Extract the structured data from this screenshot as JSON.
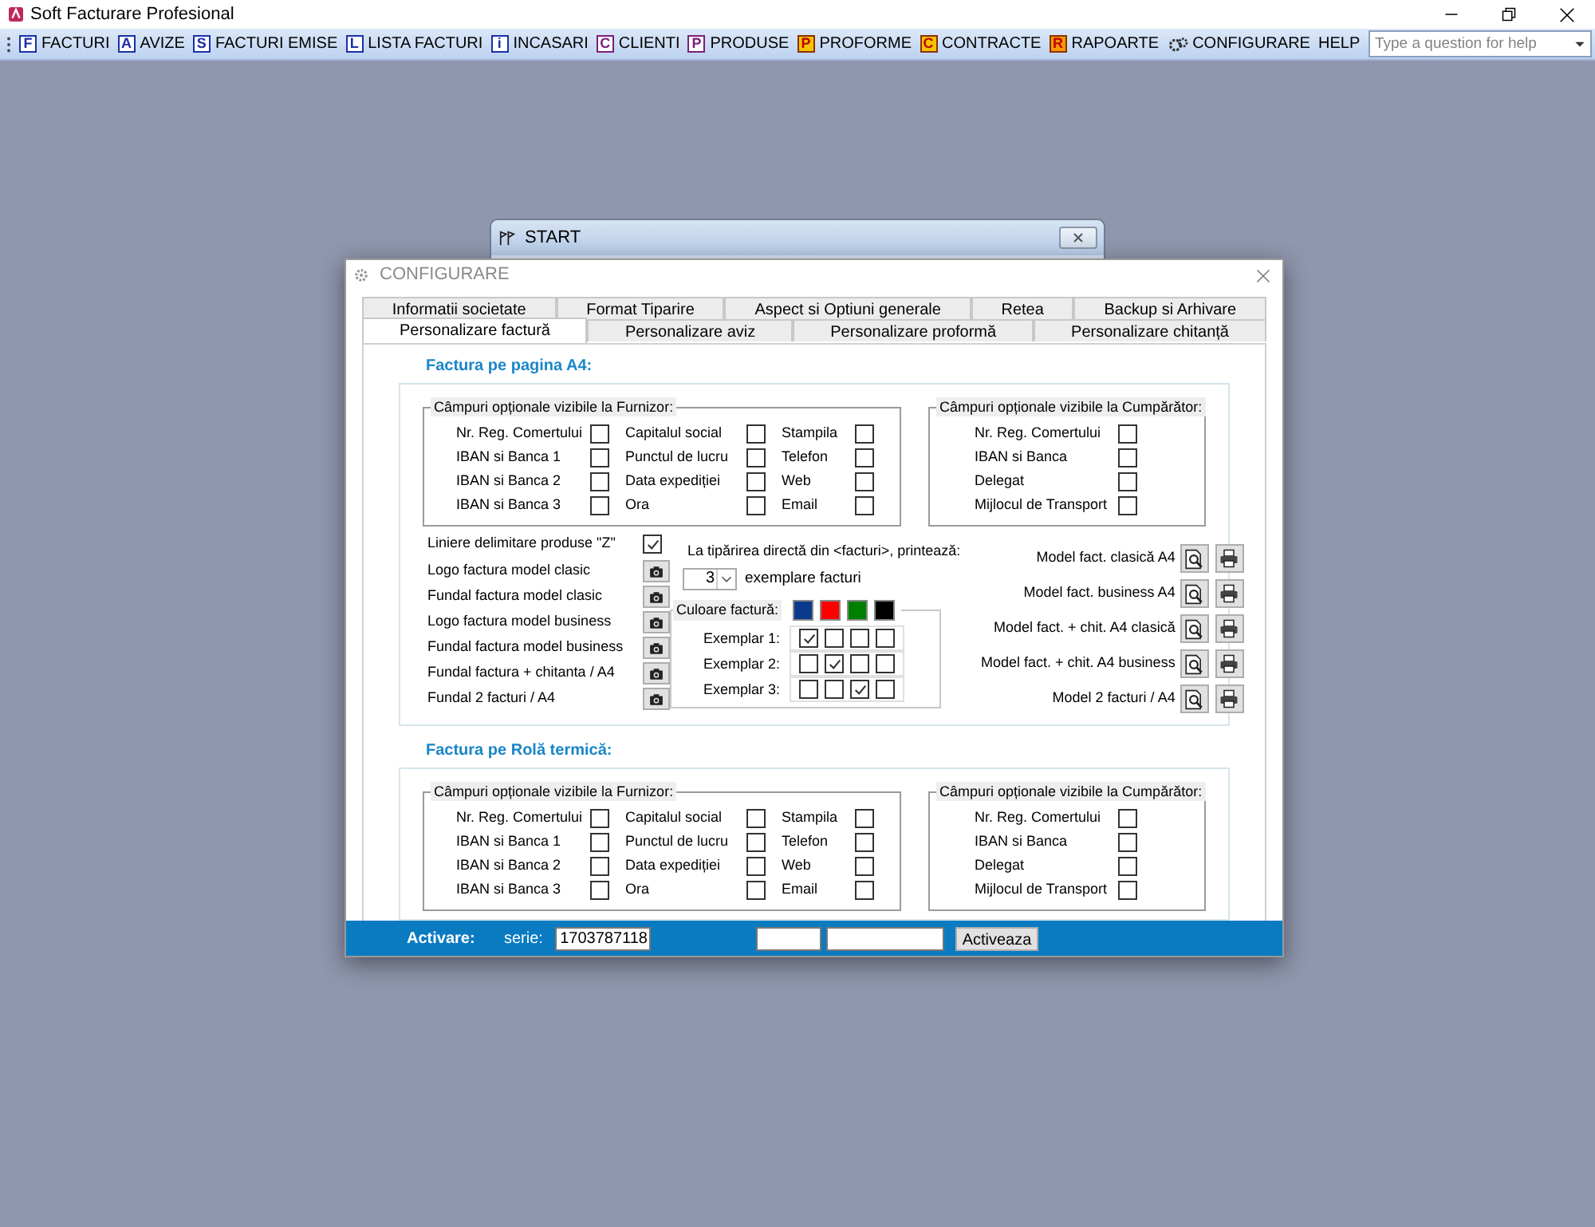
{
  "app_title": "Soft Facturare Profesional",
  "menu": [
    {
      "label": "FACTURI",
      "kind": "outline",
      "icon": "F",
      "color": "#1a2fa8"
    },
    {
      "label": "AVIZE",
      "kind": "outline",
      "icon": "A",
      "color": "#1a2fa8"
    },
    {
      "label": "FACTURI EMISE",
      "kind": "outline",
      "icon": "S",
      "color": "#1a2fa8"
    },
    {
      "label": "LISTA FACTURI",
      "kind": "outline",
      "icon": "L",
      "color": "#1a2fa8"
    },
    {
      "label": "INCASARI",
      "kind": "outline",
      "icon": "i",
      "color": "#1a2fa8"
    },
    {
      "label": "CLIENTI",
      "kind": "outline",
      "icon": "C",
      "color": "#7a1f7a"
    },
    {
      "label": "PRODUSE",
      "kind": "outline",
      "icon": "P",
      "color": "#7a1f7a"
    },
    {
      "label": "PROFORME",
      "kind": "filled",
      "icon": "P",
      "color": "#f5c400"
    },
    {
      "label": "CONTRACTE",
      "kind": "filled",
      "icon": "C",
      "color": "#f5c400"
    },
    {
      "label": "RAPOARTE",
      "kind": "filled",
      "icon": "R",
      "color": "#f59a00"
    },
    {
      "label": "CONFIGURARE",
      "kind": "gear"
    },
    {
      "label": "HELP",
      "kind": "none"
    }
  ],
  "help_search": {
    "placeholder": "Type a question for help"
  },
  "start_window": {
    "title": "START"
  },
  "dialog": {
    "title": "CONFIGURARE",
    "tab_rows": [
      [
        {
          "label": "Informatii societate",
          "selected": false
        },
        {
          "label": "Format Tiparire",
          "selected": false
        },
        {
          "label": "Aspect si Optiuni generale",
          "selected": false
        },
        {
          "label": "Retea",
          "selected": false
        },
        {
          "label": "Backup si Arhivare",
          "selected": false
        }
      ],
      [
        {
          "label": "Personalizare factură",
          "selected": true
        },
        {
          "label": "Personalizare aviz",
          "selected": false
        },
        {
          "label": "Personalizare proformă",
          "selected": false
        },
        {
          "label": "Personalizare chitanță",
          "selected": false
        }
      ]
    ],
    "a4": {
      "title": "Factura pe pagina A4:",
      "furnizor": {
        "legend": "Câmpuri opționale vizibile la Furnizor:",
        "columns": [
          [
            {
              "label": "Nr. Reg. Comertului",
              "checked": false
            },
            {
              "label": "IBAN si Banca 1",
              "checked": false
            },
            {
              "label": "IBAN si Banca 2",
              "checked": false
            },
            {
              "label": "IBAN si Banca 3",
              "checked": false
            }
          ],
          [
            {
              "label": "Capitalul social",
              "checked": false
            },
            {
              "label": "Punctul de lucru",
              "checked": false
            },
            {
              "label": "Data expediției",
              "checked": false
            },
            {
              "label": "Ora",
              "checked": false
            }
          ],
          [
            {
              "label": "Stampila",
              "checked": false
            },
            {
              "label": "Telefon",
              "checked": false
            },
            {
              "label": "Web",
              "checked": false
            },
            {
              "label": "Email",
              "checked": false
            }
          ]
        ]
      },
      "cumparator": {
        "legend": "Câmpuri opționale vizibile la Cumpărător:",
        "columns": [
          [
            {
              "label": "Nr. Reg. Comertului",
              "checked": false
            },
            {
              "label": "IBAN si Banca",
              "checked": false
            },
            {
              "label": "Delegat",
              "checked": false
            },
            {
              "label": "Mijlocul de Transport",
              "checked": false
            }
          ]
        ]
      },
      "lines": {
        "label": "Liniere delimitare produse \"Z\"",
        "checked": true
      },
      "images": [
        "Logo factura model clasic",
        "Fundal factura model clasic",
        "Logo factura model business",
        "Fundal factura model business",
        "Fundal factura + chitanta / A4",
        "Fundal 2 facturi / A4"
      ],
      "print": {
        "label": "La tipărirea directă din <facturi>, printează:",
        "copies": "3",
        "copies_label": "exemplare facturi"
      },
      "colors": {
        "legend": "Culoare factură:",
        "swatches": [
          {
            "color": "#0b3a8c"
          },
          {
            "color": "#ff0000"
          },
          {
            "color": "#008000"
          },
          {
            "color": "#000000"
          }
        ],
        "copies": [
          {
            "label": "Exemplar 1:",
            "checks": [
              true,
              false,
              false,
              false
            ]
          },
          {
            "label": "Exemplar 2:",
            "checks": [
              false,
              true,
              false,
              false
            ]
          },
          {
            "label": "Exemplar 3:",
            "checks": [
              false,
              false,
              true,
              false
            ]
          }
        ]
      },
      "models": [
        "Model fact. clasică A4",
        "Model fact. business A4",
        "Model fact. + chit. A4 clasică",
        "Model fact. + chit. A4 business",
        "Model 2 facturi / A4"
      ]
    },
    "roll": {
      "title": "Factura pe Rolă termică:",
      "furnizor": {
        "legend": "Câmpuri opționale vizibile la Furnizor:",
        "columns": [
          [
            {
              "label": "Nr. Reg. Comertului",
              "checked": false
            },
            {
              "label": "IBAN si Banca 1",
              "checked": false
            },
            {
              "label": "IBAN si Banca 2",
              "checked": false
            },
            {
              "label": "IBAN si Banca 3",
              "checked": false
            }
          ],
          [
            {
              "label": "Capitalul social",
              "checked": false
            },
            {
              "label": "Punctul de lucru",
              "checked": false
            },
            {
              "label": "Data expediției",
              "checked": false
            },
            {
              "label": "Ora",
              "checked": false
            }
          ],
          [
            {
              "label": "Stampila",
              "checked": false
            },
            {
              "label": "Telefon",
              "checked": false
            },
            {
              "label": "Web",
              "checked": false
            },
            {
              "label": "Email",
              "checked": false
            }
          ]
        ]
      },
      "cumparator": {
        "legend": "Câmpuri opționale vizibile la Cumpărător:",
        "columns": [
          [
            {
              "label": "Nr. Reg. Comertului",
              "checked": false
            },
            {
              "label": "IBAN si Banca",
              "checked": false
            },
            {
              "label": "Delegat",
              "checked": false
            },
            {
              "label": "Mijlocul de Transport",
              "checked": false
            }
          ]
        ]
      }
    },
    "activation": {
      "label": "Activare:",
      "serie_label": "serie:",
      "serie": "1703787118",
      "button": "Activeaza"
    }
  }
}
